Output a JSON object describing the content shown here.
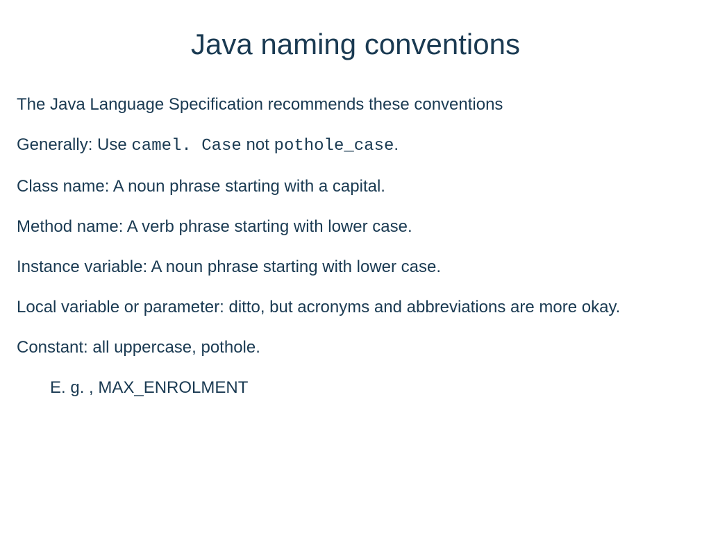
{
  "title": "Java naming conventions",
  "intro": "The Java Language Specification recommends these conventions",
  "generally_prefix": "Generally: Use ",
  "generally_code1": "camel. Case",
  "generally_mid": " not ",
  "generally_code2": "pothole_case",
  "generally_suffix": ".",
  "class_name": "Class name: A noun phrase starting with a capital.",
  "method_name": "Method  name: A verb phrase starting with lower case.",
  "instance_var": "Instance variable: A noun phrase starting with lower case.",
  "local_var": "Local variable or parameter: ditto, but acronyms and abbreviations are more okay.",
  "constant": "Constant: all uppercase, pothole.",
  "example": "E. g. , MAX_ENROLMENT"
}
